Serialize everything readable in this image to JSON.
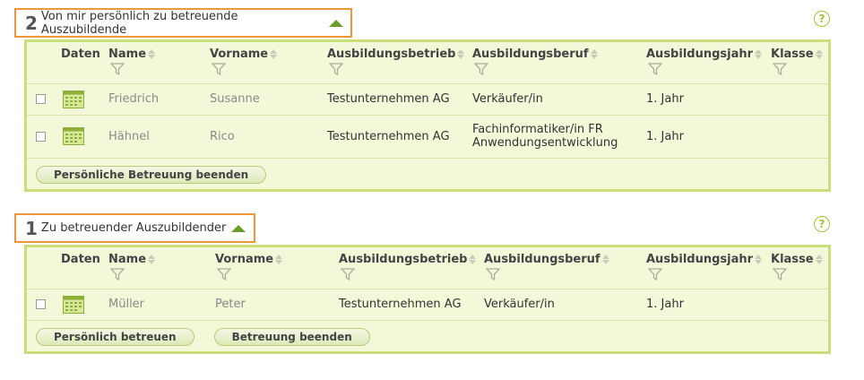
{
  "sections": [
    {
      "count": "2",
      "title": "Von mir persönlich zu betreuende Auszubildende",
      "help": "?",
      "columns": {
        "daten": "Daten",
        "name": "Name",
        "vorname": "Vorname",
        "betrieb": "Ausbildungsbetrieb",
        "beruf": "Ausbildungsberuf",
        "jahr": "Ausbildungsjahr",
        "klasse": "Klasse"
      },
      "rows": [
        {
          "name": "Friedrich",
          "vorname": "Susanne",
          "betrieb": "Testunternehmen AG",
          "beruf": "Verkäufer/in",
          "beruf2": "",
          "jahr": "1. Jahr",
          "klasse": ""
        },
        {
          "name": "Hähnel",
          "vorname": "Rico",
          "betrieb": "Testunternehmen AG",
          "beruf": "Fachinformatiker/in FR",
          "beruf2": "Anwendungsentwicklung",
          "jahr": "1. Jahr",
          "klasse": ""
        }
      ],
      "buttons": [
        "Persönliche Betreuung beenden"
      ]
    },
    {
      "count": "1",
      "title": "Zu betreuender Auszubildender",
      "help": "?",
      "columns": {
        "daten": "Daten",
        "name": "Name",
        "vorname": "Vorname",
        "betrieb": "Ausbildungsbetrieb",
        "beruf": "Ausbildungsberuf",
        "jahr": "Ausbildungsjahr",
        "klasse": "Klasse"
      },
      "rows": [
        {
          "name": "Müller",
          "vorname": "Peter",
          "betrieb": "Testunternehmen AG",
          "beruf": "Verkäufer/in",
          "beruf2": "",
          "jahr": "1. Jahr",
          "klasse": ""
        }
      ],
      "buttons": [
        "Persönlich betreuen",
        "Betreuung beenden"
      ]
    }
  ],
  "colors": {
    "accent_orange": "#f0963a",
    "panel_border": "#c9df79",
    "panel_bg": "#f2f8d8",
    "arrow_green": "#6b9b2a"
  }
}
